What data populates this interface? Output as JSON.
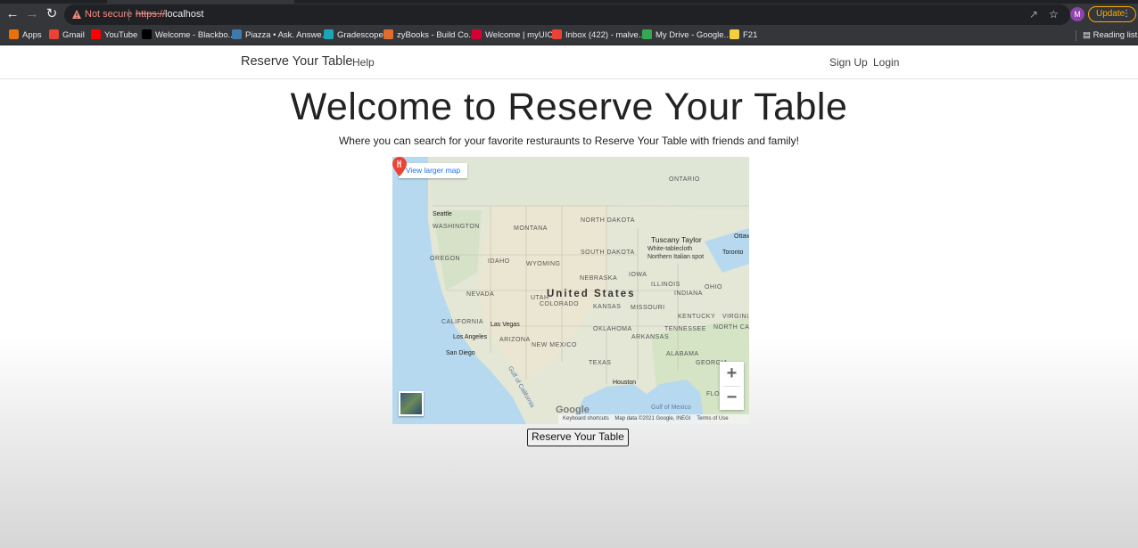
{
  "browser": {
    "not_secure": "Not secure",
    "url_scheme": "https://",
    "url_host": "localhost",
    "avatar_initial": "M",
    "update_label": "Update",
    "reading_list": "Reading list"
  },
  "bookmarks": [
    {
      "label": "Apps",
      "icon": "apps-grid-icon",
      "color": "#e8710a"
    },
    {
      "label": "Gmail",
      "icon": "gmail-icon",
      "color": "#ea4335"
    },
    {
      "label": "YouTube",
      "icon": "youtube-icon",
      "color": "#ff0000"
    },
    {
      "label": "Welcome - Blackbo...",
      "icon": "blackboard-icon",
      "color": "#000000"
    },
    {
      "label": "Piazza • Ask. Answe...",
      "icon": "piazza-icon",
      "color": "#3e7aab"
    },
    {
      "label": "Gradescope",
      "icon": "gradescope-icon",
      "color": "#1ba5b5"
    },
    {
      "label": "zyBooks - Build Co...",
      "icon": "zybooks-icon",
      "color": "#e06c2e"
    },
    {
      "label": "Welcome | myUIC",
      "icon": "uic-icon",
      "color": "#d50032"
    },
    {
      "label": "Inbox (422) - malve...",
      "icon": "gmail-icon",
      "color": "#ea4335"
    },
    {
      "label": "My Drive - Google...",
      "icon": "drive-icon",
      "color": "#34a853"
    },
    {
      "label": "F21",
      "icon": "folder-icon",
      "color": "#f4d03f"
    }
  ],
  "site": {
    "brand": "Reserve Your Table",
    "help": "Help",
    "signup": "Sign Up",
    "login": "Login",
    "title": "Welcome to Reserve Your Table",
    "subtitle": "Where you can search for your favorite resturaunts to Reserve Your Table with friends and family!",
    "reserve_button": "Reserve Your Table"
  },
  "map": {
    "view_larger": "View larger map",
    "country": "United States",
    "place_name": "Tuscany Taylor",
    "place_sub1": "White-tablecloth",
    "place_sub2": "Northern Italian spot",
    "google": "Google",
    "keyboard": "Keyboard shortcuts",
    "mapdata": "Map data ©2021 Google, INEGI",
    "terms": "Terms of Use",
    "region_labels": [
      "ONTARIO",
      "WASHINGTON",
      "MONTANA",
      "NORTH DAKOTA",
      "SOUTH DAKOTA",
      "OREGON",
      "IDAHO",
      "WYOMING",
      "NEBRASKA",
      "IOWA",
      "ILLINOIS",
      "OHIO",
      "INDIANA",
      "NEVADA",
      "UTAH",
      "COLORADO",
      "KANSAS",
      "MISSOURI",
      "KENTUCKY",
      "VIRGINIA",
      "CALIFORNIA",
      "ARIZONA",
      "NEW MEXICO",
      "OKLAHOMA",
      "ARKANSAS",
      "TENNESSEE",
      "NORTH CAROLINA",
      "TEXAS",
      "ALABAMA",
      "GEORGIA",
      "FLO"
    ],
    "cities": [
      "Seattle",
      "Las Vegas",
      "Los Angeles",
      "San Diego",
      "Houston",
      "Toronto",
      "Ottaw",
      "Gulf of Mexico",
      "Gulf of California"
    ]
  }
}
